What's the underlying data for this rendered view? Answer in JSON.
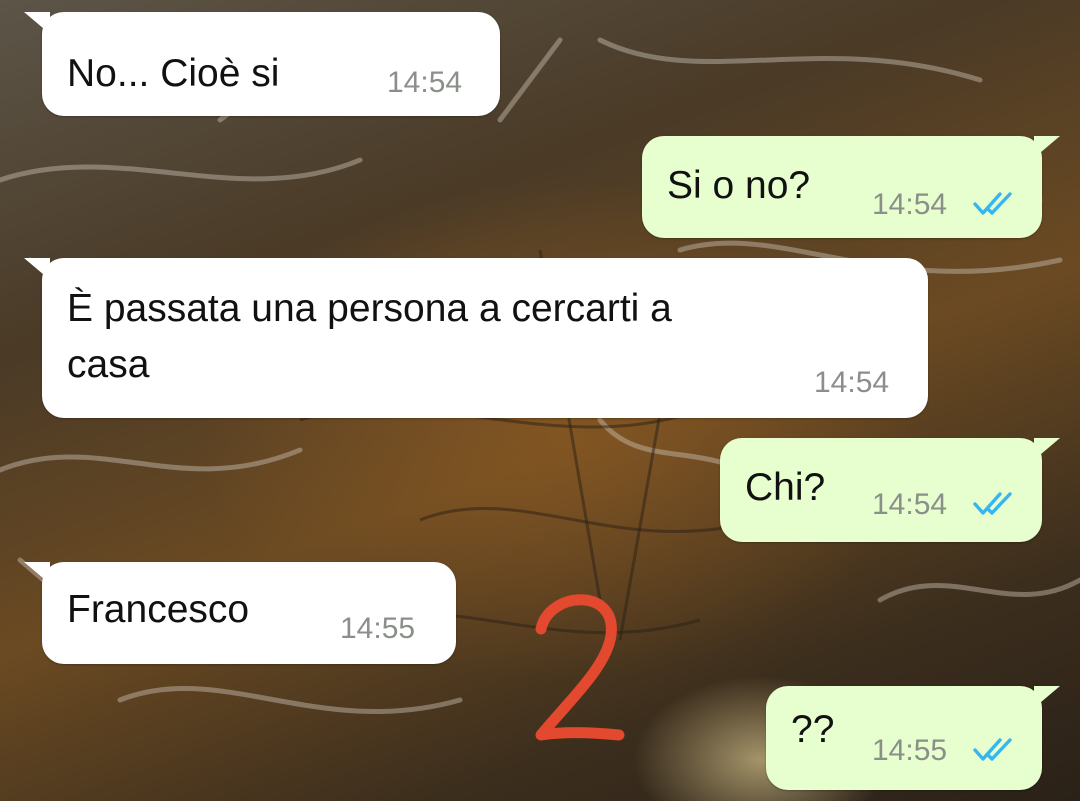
{
  "messages": [
    {
      "direction": "incoming",
      "text": "No... Cioè si",
      "time": "14:54"
    },
    {
      "direction": "outgoing",
      "text": "Si o no?",
      "time": "14:54",
      "status": "read"
    },
    {
      "direction": "incoming",
      "text": "È passata una persona a cercarti a\ncasa",
      "time": "14:54"
    },
    {
      "direction": "outgoing",
      "text": "Chi?",
      "time": "14:54",
      "status": "read"
    },
    {
      "direction": "incoming",
      "text": "Francesco",
      "time": "14:55"
    },
    {
      "direction": "outgoing",
      "text": "??",
      "time": "14:55",
      "status": "read"
    }
  ],
  "annotation": {
    "text": "2",
    "color": "#e2492f"
  },
  "colors": {
    "incoming_bubble": "#ffffff",
    "outgoing_bubble": "#e7fecf",
    "read_ticks": "#34b7f1",
    "timestamp": "#8a8f8a"
  },
  "icons": {
    "read_receipt": "double-check-icon"
  }
}
